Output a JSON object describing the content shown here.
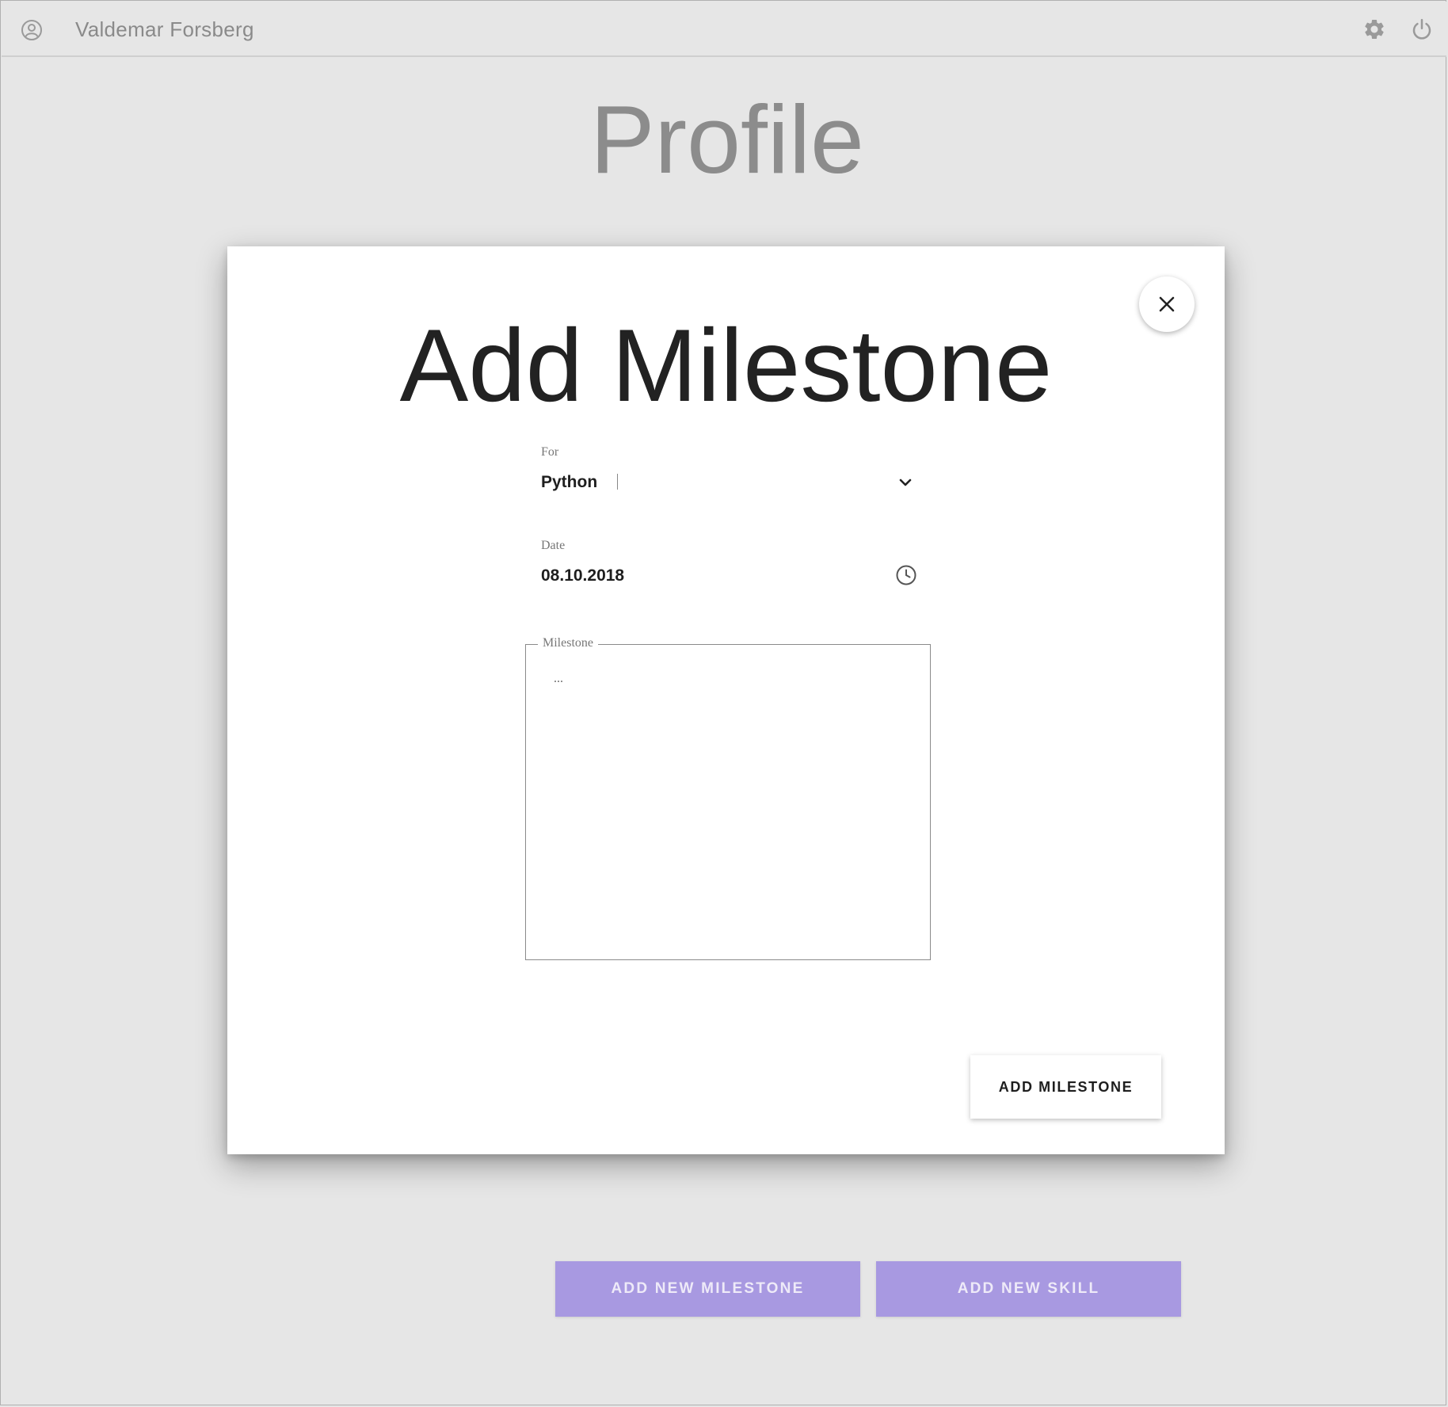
{
  "header": {
    "user_name": "Valdemar Forsberg",
    "icons": [
      "user-icon",
      "gear-icon",
      "power-icon"
    ]
  },
  "page": {
    "title": "Profile",
    "buttons": {
      "add_milestone": "ADD NEW MILESTONE",
      "add_skill": "ADD NEW SKILL"
    }
  },
  "modal": {
    "title": "Add Milestone",
    "for_field": {
      "label": "For",
      "value": "Python"
    },
    "date_field": {
      "label": "Date",
      "value": "08.10.2018"
    },
    "milestone_field": {
      "label": "Milestone",
      "placeholder": "..."
    },
    "submit_label": "ADD MILESTONE"
  },
  "colors": {
    "background": "#e6e6e6",
    "accent": "#a899e1",
    "modal": "#ffffff"
  }
}
